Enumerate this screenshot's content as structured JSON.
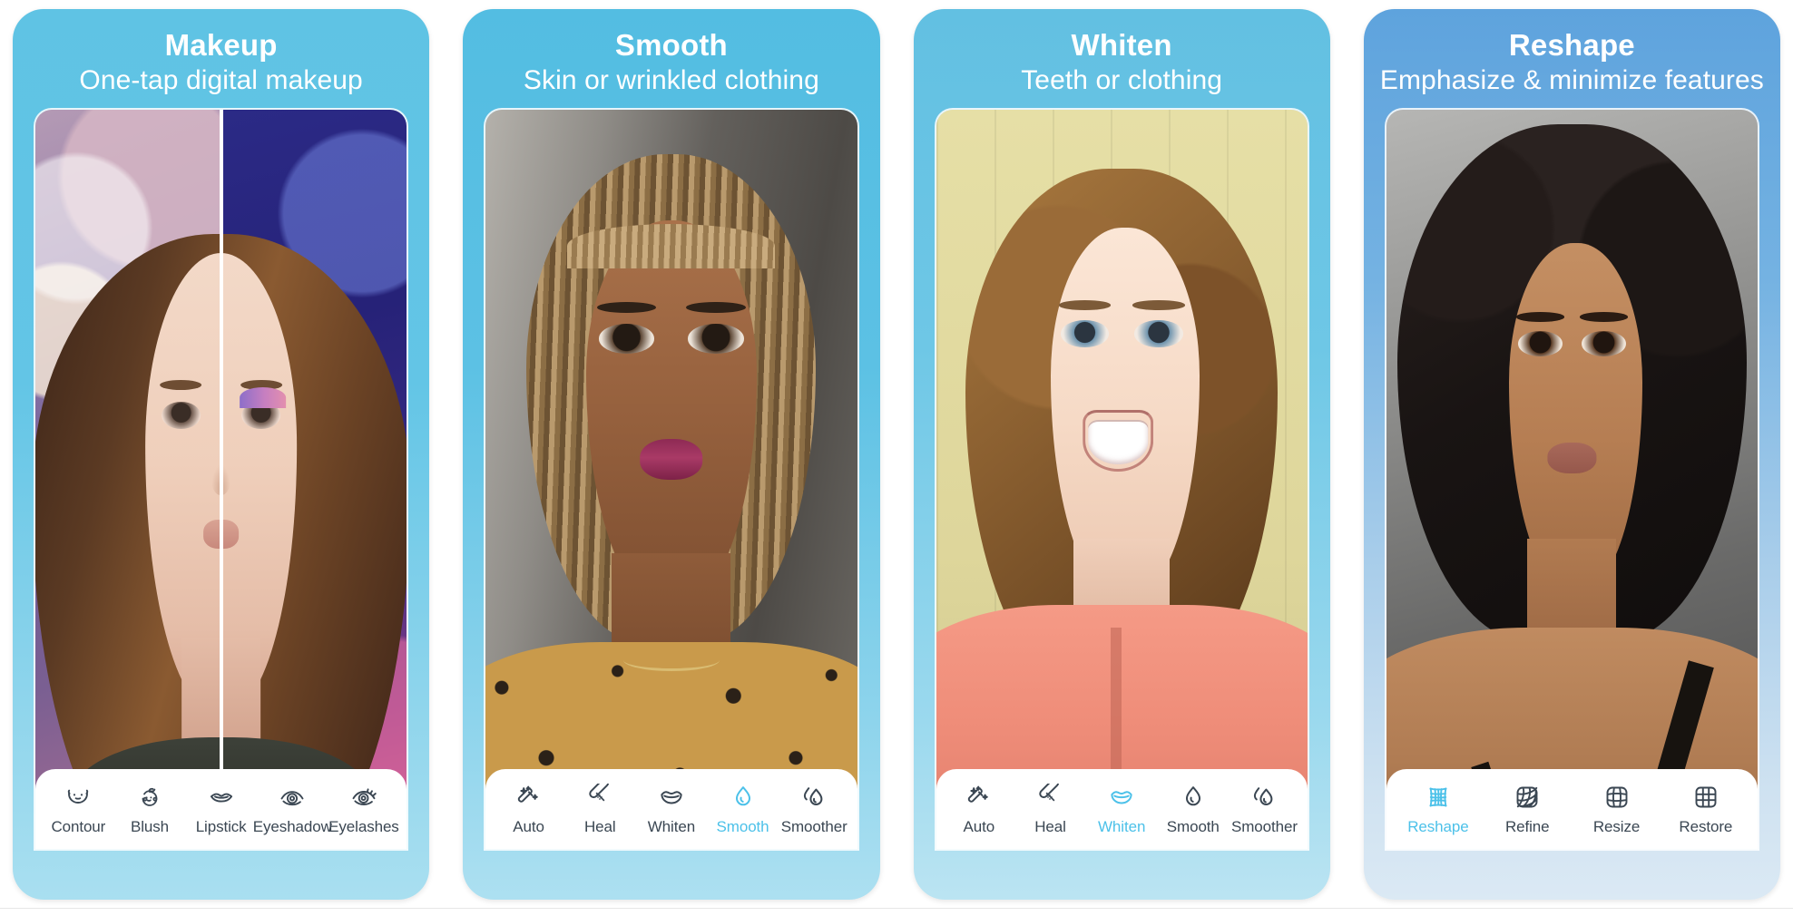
{
  "theme": {
    "accent": "#4cc1e9",
    "panel_blue": "#5fc3e4",
    "panel_blue_4": "#5ea3dd",
    "label_color": "#3b4753",
    "card_bg": "#ffffff"
  },
  "panels": [
    {
      "title": "Makeup",
      "subtitle": "One-tap digital makeup",
      "photo": "before-after-makeup-portrait",
      "tools": [
        {
          "label": "Contour",
          "icon": "contour-icon",
          "active": false
        },
        {
          "label": "Blush",
          "icon": "blush-icon",
          "active": false
        },
        {
          "label": "Lipstick",
          "icon": "lipstick-icon",
          "active": false
        },
        {
          "label": "Eyeshadow",
          "icon": "eyeshadow-icon",
          "active": false
        },
        {
          "label": "Eyelashes",
          "icon": "eyelashes-icon",
          "active": false
        }
      ]
    },
    {
      "title": "Smooth",
      "subtitle": "Skin or wrinkled clothing",
      "photo": "braided-hair-portrait",
      "tools": [
        {
          "label": "Auto",
          "icon": "magic-wand-icon",
          "active": false
        },
        {
          "label": "Heal",
          "icon": "bandage-icon",
          "active": false
        },
        {
          "label": "Whiten",
          "icon": "teeth-smile-icon",
          "active": false
        },
        {
          "label": "Smooth",
          "icon": "droplet-icon",
          "active": true
        },
        {
          "label": "Smoother",
          "icon": "double-droplet-icon",
          "active": false
        }
      ]
    },
    {
      "title": "Whiten",
      "subtitle": "Teeth or clothing",
      "photo": "curly-hair-smiling-portrait",
      "tools": [
        {
          "label": "Auto",
          "icon": "magic-wand-icon",
          "active": false
        },
        {
          "label": "Heal",
          "icon": "bandage-icon",
          "active": false
        },
        {
          "label": "Whiten",
          "icon": "teeth-smile-icon",
          "active": true
        },
        {
          "label": "Smooth",
          "icon": "droplet-icon",
          "active": false
        },
        {
          "label": "Smoother",
          "icon": "double-droplet-icon",
          "active": false
        }
      ]
    },
    {
      "title": "Reshape",
      "subtitle": "Emphasize & minimize features",
      "photo": "dark-curly-hair-portrait",
      "tools": [
        {
          "label": "Reshape",
          "icon": "warp-grid-icon",
          "active": true
        },
        {
          "label": "Refine",
          "icon": "refine-grid-icon",
          "active": false
        },
        {
          "label": "Resize",
          "icon": "resize-grid-icon",
          "active": false
        },
        {
          "label": "Restore",
          "icon": "restore-grid-icon",
          "active": false
        }
      ]
    }
  ]
}
